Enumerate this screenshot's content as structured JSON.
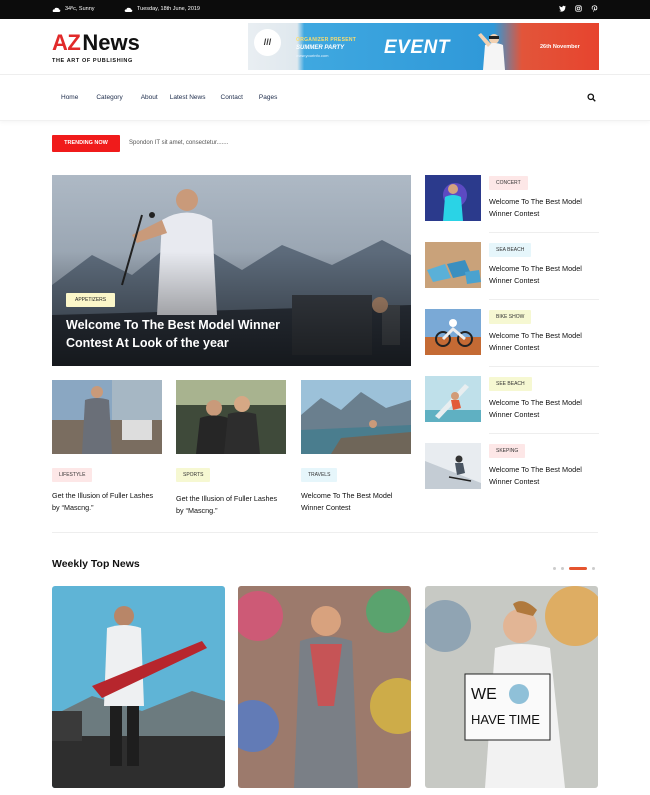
{
  "topbar": {
    "weather": "34ºc, Sunny",
    "date": "Tuesday, 18th June, 2019",
    "social_icons": [
      "twitter-icon",
      "instagram-icon",
      "pinterest-icon"
    ]
  },
  "logo": {
    "part1": "AZ",
    "part2": "News",
    "tagline": "THE ART OF PUBLISHING"
  },
  "banner": {
    "organizer": "ORGANIZER PRESENT",
    "summer": "SUMMER PARTY",
    "url": "www.yourinfo.com",
    "event": "EVENT",
    "date": "26th November"
  },
  "nav": {
    "items": [
      "Home",
      "Category",
      "About",
      "Latest News",
      "Contact",
      "Pages"
    ]
  },
  "trending": {
    "label": "TRENDING NOW",
    "text": "Spondon IT sit amet, consectetur......."
  },
  "hero": {
    "tag": "APPETIZERS",
    "title": "Welcome To The Best Model Winner Contest At Look of the year"
  },
  "cards": [
    {
      "tag": "LIFESTYLE",
      "title": "Get the Illusion of Fuller Lashes by “Mascng.”"
    },
    {
      "tag": "SPORTS",
      "title": "Get the Illusion of Fuller Lashes by “Mascng.”"
    },
    {
      "tag": "TRAVELS",
      "title": "Welcome To The Best Model Winner Contest"
    }
  ],
  "side": [
    {
      "tag": "CONCERT",
      "title": "Welcome To The Best Model Winner Contest"
    },
    {
      "tag": "SEA BEACH",
      "title": "Welcome To The Best Model Winner Contest"
    },
    {
      "tag": "BIKE SHOW",
      "title": "Welcome To The Best Model Winner Contest"
    },
    {
      "tag": "SEE BEACH",
      "title": "Welcome To The Best Model Winner Contest"
    },
    {
      "tag": "SKEPING",
      "title": "Welcome To The Best Model Winner Contest"
    }
  ],
  "weekly": {
    "title": "Weekly Top News"
  },
  "colors": {
    "accent": "#e12a2a",
    "trending": "#f01b1b",
    "nav_text": "#1b2a49",
    "slider_active": "#e5542e"
  }
}
